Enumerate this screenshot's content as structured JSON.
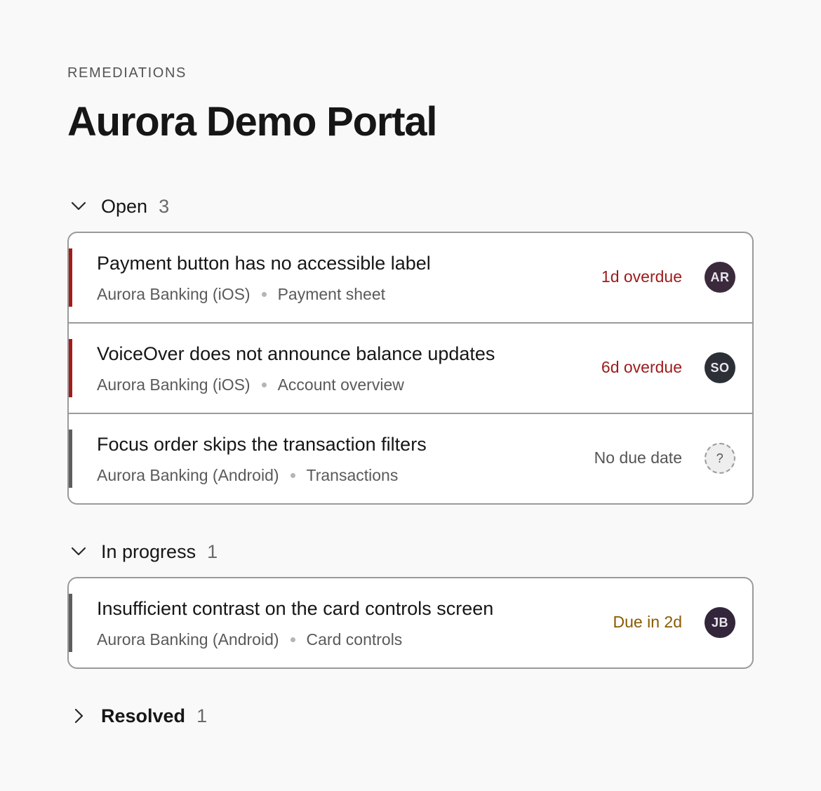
{
  "page": {
    "eyebrow": "REMEDIATIONS",
    "title": "Aurora Demo Portal"
  },
  "sections": {
    "open": {
      "label": "Open",
      "count": "3",
      "expanded": true,
      "items": [
        {
          "title": "Payment button has no accessible label",
          "app": "Aurora Banking (iOS)",
          "screen": "Payment sheet",
          "due": "1d overdue",
          "due_status": "overdue",
          "assignee": "AR",
          "avatar_color": "#3b2a3c",
          "accent_color": "#a21c1c"
        },
        {
          "title": "VoiceOver does not announce balance updates",
          "app": "Aurora Banking (iOS)",
          "screen": "Account overview",
          "due": "6d overdue",
          "due_status": "overdue",
          "assignee": "SO",
          "avatar_color": "#2c2f36",
          "accent_color": "#a21c1c"
        },
        {
          "title": "Focus order skips the transaction filters",
          "app": "Aurora Banking (Android)",
          "screen": "Transactions",
          "due": "No due date",
          "due_status": "none",
          "assignee": "?",
          "avatar_color": "#eeeeee",
          "accent_color": "#5e5e5e"
        }
      ]
    },
    "in_progress": {
      "label": "In progress",
      "count": "1",
      "expanded": true,
      "items": [
        {
          "title": "Insufficient contrast on the card controls screen",
          "app": "Aurora Banking (Android)",
          "screen": "Card controls",
          "due": "Due in 2d",
          "due_status": "soon",
          "assignee": "JB",
          "avatar_color": "#33263a",
          "accent_color": "#5e5e5e"
        }
      ]
    },
    "resolved": {
      "label": "Resolved",
      "count": "1",
      "expanded": false
    }
  },
  "icons": {
    "expanded": "chevron-down-icon",
    "collapsed": "chevron-right-icon"
  },
  "colors": {
    "overdue": "#9c1b1b",
    "due_soon": "#8a5a00",
    "no_due": "#555555"
  }
}
